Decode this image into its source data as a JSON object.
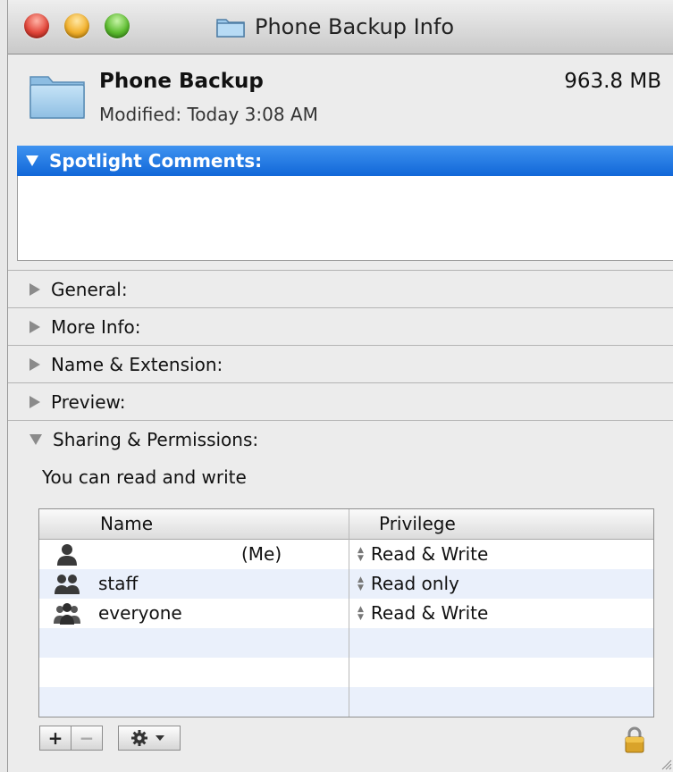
{
  "window": {
    "title": "Phone Backup Info",
    "controls": [
      "close",
      "minimize",
      "zoom"
    ]
  },
  "header": {
    "icon": "folder-icon",
    "name": "Phone Backup",
    "modified": "Modified: Today 3:08 AM",
    "size": "963.8 MB"
  },
  "spotlight": {
    "label": "Spotlight Comments:",
    "comment": ""
  },
  "sections": [
    {
      "label": "General:",
      "expanded": false
    },
    {
      "label": "More Info:",
      "expanded": false
    },
    {
      "label": "Name & Extension:",
      "expanded": false
    },
    {
      "label": "Preview:",
      "expanded": false
    },
    {
      "label": "Sharing & Permissions:",
      "expanded": true
    }
  ],
  "permissions": {
    "note": "You can read and write",
    "columns": [
      "Name",
      "Privilege"
    ],
    "rows": [
      {
        "name": "",
        "suffix": "(Me)",
        "privilege": "Read & Write",
        "icon": "single-user-icon"
      },
      {
        "name": "staff",
        "suffix": "",
        "privilege": "Read only",
        "icon": "group-icon"
      },
      {
        "name": "everyone",
        "suffix": "",
        "privilege": "Read & Write",
        "icon": "everyone-icon"
      }
    ]
  },
  "buttons": {
    "add": "+",
    "remove": "−"
  },
  "colors": {
    "selection_blue": "#1a6fdf",
    "row_alt": "#eaf0fb"
  }
}
